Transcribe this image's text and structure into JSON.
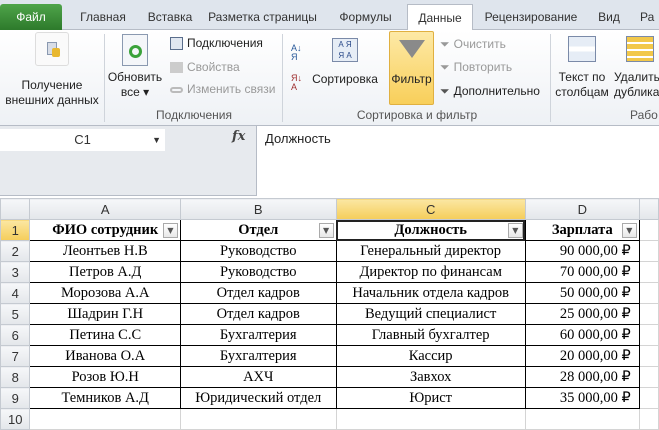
{
  "tabs": [
    "Файл",
    "Главная",
    "Вставка",
    "Разметка страницы",
    "Формулы",
    "Данные",
    "Рецензирование",
    "Вид",
    "Ра"
  ],
  "ribbon": {
    "get_external": "Получение внешних данных",
    "refresh_all_1": "Обновить",
    "refresh_all_2": "все",
    "connections": "Подключения",
    "properties": "Свойства",
    "edit_links": "Изменить связи",
    "group_connections": "Подключения",
    "sort": "Сортировка",
    "filter": "Фильтр",
    "clear": "Очистить",
    "reapply": "Повторить",
    "advanced": "Дополнительно",
    "group_sort_filter": "Сортировка и фильтр",
    "text_to_columns_1": "Текст по",
    "text_to_columns_2": "столбцам",
    "remove_dup_1": "Удалить",
    "remove_dup_2": "дубликаты",
    "group_data_tools": "Рабо"
  },
  "formula_bar": {
    "name_box": "C1",
    "fx": "fx",
    "content": "Должность"
  },
  "columns": [
    "A",
    "B",
    "C",
    "D"
  ],
  "headers": [
    "ФИО сотрудник",
    "Отдел",
    "Должность",
    "Зарплата"
  ],
  "rows": [
    [
      "Леонтьев Н.В",
      "Руководство",
      "Генеральный директор",
      "90 000,00 ₽"
    ],
    [
      "Петров А.Д",
      "Руководство",
      "Директор по финансам",
      "70 000,00 ₽"
    ],
    [
      "Морозова А.А",
      "Отдел кадров",
      "Начальник отдела кадров",
      "50 000,00 ₽"
    ],
    [
      "Шадрин Г.Н",
      "Отдел кадров",
      "Ведущий специалист",
      "25 000,00 ₽"
    ],
    [
      "Петина С.С",
      "Бухгалтерия",
      "Главный бухгалтер",
      "60 000,00 ₽"
    ],
    [
      "Иванова О.А",
      "Бухгалтерия",
      "Кассир",
      "20 000,00 ₽"
    ],
    [
      "Розов Ю.Н",
      "АХЧ",
      "Завхох",
      "28 000,00 ₽"
    ],
    [
      "Темников А.Д",
      "Юридический отдел",
      "Юрист",
      "35 000,00 ₽"
    ]
  ],
  "row_numbers": [
    "1",
    "2",
    "3",
    "4",
    "5",
    "6",
    "7",
    "8",
    "9",
    "10"
  ]
}
